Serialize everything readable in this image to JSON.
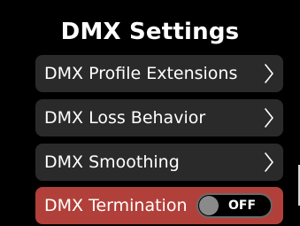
{
  "screen": {
    "title": "DMX Settings"
  },
  "menu": {
    "items": [
      {
        "label": "DMX Profile Extensions",
        "icon": "chevron-right-icon"
      },
      {
        "label": "DMX Loss Behavior",
        "icon": "chevron-right-icon"
      },
      {
        "label": "DMX Smoothing",
        "icon": "chevron-right-icon"
      },
      {
        "label": "DMX Termination",
        "toggle_state": "OFF"
      }
    ]
  },
  "colors": {
    "background": "#000000",
    "item_background": "#2a2a2a",
    "selected_item_background": "#b2403a",
    "text": "#ffffff",
    "toggle_knob": "#8a8a8a"
  }
}
